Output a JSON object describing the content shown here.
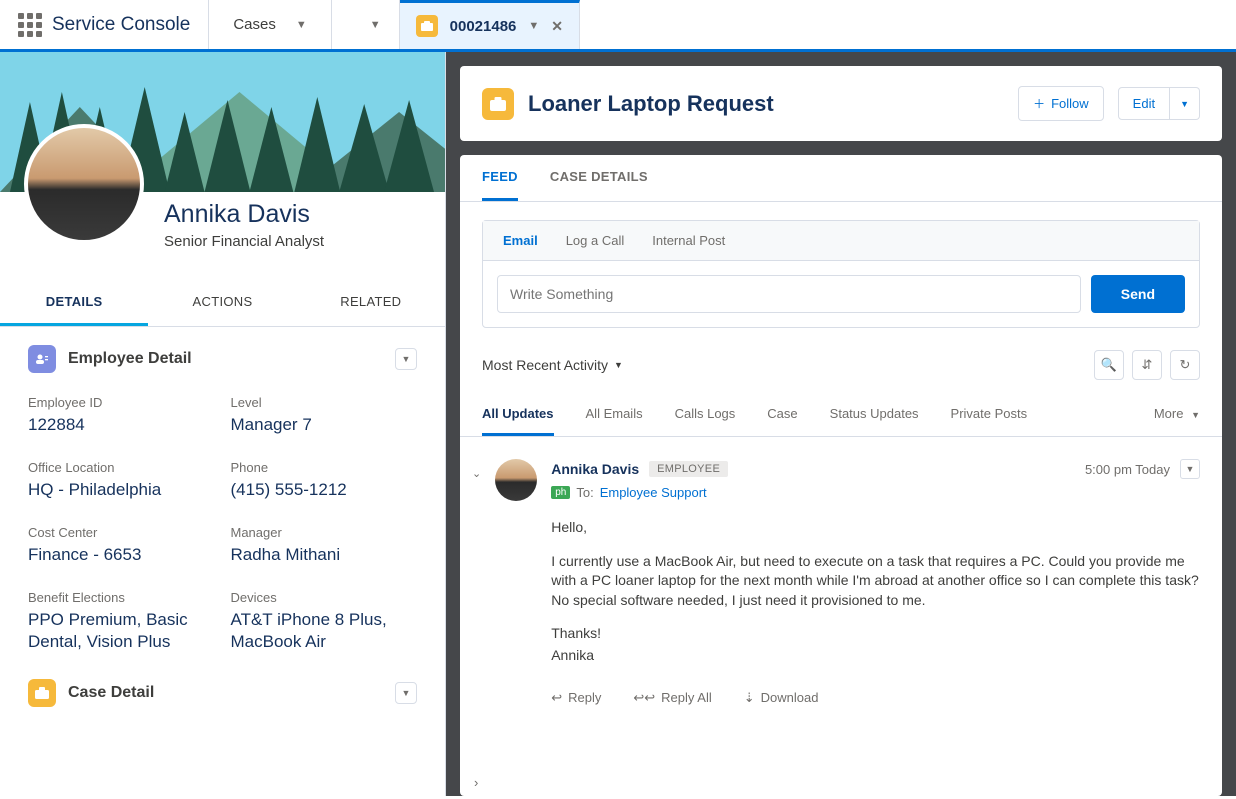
{
  "app_name": "Service Console",
  "nav": {
    "cases_label": "Cases"
  },
  "workspace_tab": {
    "number": "00021486"
  },
  "person": {
    "name": "Annika Davis",
    "title": "Senior Financial Analyst"
  },
  "left_tabs": {
    "details": "DETAILS",
    "actions": "ACTIONS",
    "related": "RELATED"
  },
  "employee_section": {
    "title": "Employee Detail"
  },
  "employee_fields": {
    "employee_id_label": "Employee ID",
    "employee_id": "122884",
    "level_label": "Level",
    "level": "Manager 7",
    "office_label": "Office Location",
    "office": "HQ - Philadelphia",
    "phone_label": "Phone",
    "phone": "(415) 555-1212",
    "cost_center_label": "Cost Center",
    "cost_center": "Finance - 6653",
    "manager_label": "Manager",
    "manager": "Radha Mithani",
    "benefits_label": "Benefit Elections",
    "benefits": "PPO Premium, Basic Dental, Vision Plus",
    "devices_label": "Devices",
    "devices": "AT&T iPhone 8 Plus, MacBook Air"
  },
  "case_section": {
    "title": "Case Detail"
  },
  "case_header": {
    "title": "Loaner Laptop Request",
    "follow": "Follow",
    "edit": "Edit"
  },
  "detail_tabs": {
    "feed": "FEED",
    "details": "CASE DETAILS"
  },
  "publisher": {
    "tabs": {
      "email": "Email",
      "log_call": "Log a Call",
      "internal_post": "Internal Post"
    },
    "placeholder": "Write Something",
    "send": "Send"
  },
  "sort": {
    "label": "Most Recent Activity"
  },
  "filters": {
    "all_updates": "All Updates",
    "all_emails": "All Emails",
    "calls_logs": "Calls Logs",
    "case": "Case",
    "status_updates": "Status Updates",
    "private_posts": "Private Posts",
    "more": "More"
  },
  "feed_item": {
    "author": "Annika Davis",
    "badge": "EMPLOYEE",
    "time": "5:00 pm Today",
    "to_label": "To:",
    "to_target": "Employee Support",
    "body_greeting": "Hello,",
    "body_main": "I currently use a MacBook Air, but need to execute on a task that requires a PC.  Could you provide me with a PC loaner laptop for the next month while I'm abroad at another office so I can complete this task?  No special software needed, I just need it provisioned to me.",
    "body_thanks": "Thanks!",
    "body_sign": "Annika",
    "actions": {
      "reply": "Reply",
      "reply_all": "Reply All",
      "download": "Download"
    }
  }
}
